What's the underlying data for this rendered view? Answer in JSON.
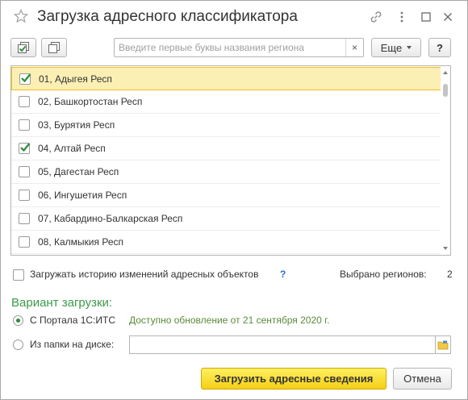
{
  "window": {
    "title": "Загрузка адресного классификатора"
  },
  "toolbar": {
    "search_placeholder": "Введите первые буквы названия региона",
    "clear_label": "×",
    "more_label": "Еще",
    "help_label": "?"
  },
  "regions": [
    {
      "label": "01, Адыгея Респ",
      "checked": true,
      "selected": true
    },
    {
      "label": "02, Башкортостан Респ",
      "checked": false,
      "selected": false
    },
    {
      "label": "03, Бурятия Респ",
      "checked": false,
      "selected": false
    },
    {
      "label": "04, Алтай Респ",
      "checked": true,
      "selected": false
    },
    {
      "label": "05, Дагестан Респ",
      "checked": false,
      "selected": false
    },
    {
      "label": "06, Ингушетия Респ",
      "checked": false,
      "selected": false
    },
    {
      "label": "07, Кабардино-Балкарская Респ",
      "checked": false,
      "selected": false
    },
    {
      "label": "08, Калмыкия Респ",
      "checked": false,
      "selected": false
    }
  ],
  "options": {
    "history_label": "Загружать историю изменений адресных объектов",
    "history_help": "?",
    "history_checked": false,
    "selected_count_label": "Выбрано регионов:",
    "selected_count": "2"
  },
  "load_variant": {
    "heading": "Вариант загрузки:",
    "portal_label": "С Портала 1С:ИТС",
    "portal_note": "Доступно обновление от 21 сентября 2020 г.",
    "folder_label": "Из папки на диске:",
    "folder_value": "",
    "selected": "portal"
  },
  "buttons": {
    "load_label": "Загрузить адресные сведения",
    "cancel_label": "Отмена"
  },
  "colors": {
    "accent_green": "#2a8a3c",
    "heading_green": "#3a9a4a",
    "selection_bg": "#fcefb4",
    "primary_button": "#f5cf15"
  }
}
